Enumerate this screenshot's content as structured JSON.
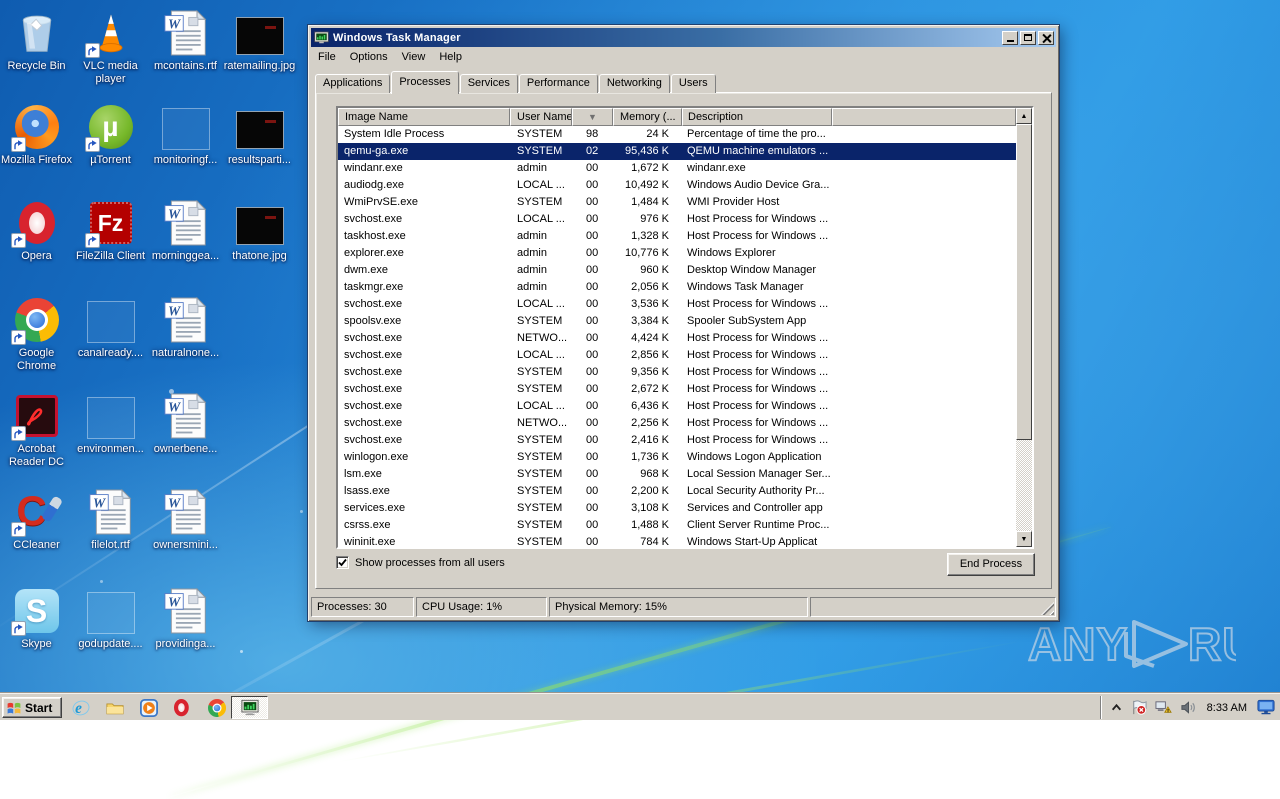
{
  "window": {
    "title": "Windows Task Manager",
    "menu": [
      "File",
      "Options",
      "View",
      "Help"
    ],
    "tabs": [
      "Applications",
      "Processes",
      "Services",
      "Performance",
      "Networking",
      "Users"
    ],
    "active_tab": "Processes",
    "processes": {
      "columns": [
        "Image Name",
        "User Name",
        "",
        "Memory (...",
        "Description"
      ],
      "sort_indicator": "▼",
      "selected_index": 1,
      "rows": [
        {
          "name": "System Idle Process",
          "user": "SYSTEM",
          "cpu": "98",
          "mem": "24 K",
          "desc": "Percentage of time the pro..."
        },
        {
          "name": "qemu-ga.exe",
          "user": "SYSTEM",
          "cpu": "02",
          "mem": "95,436 K",
          "desc": "QEMU machine emulators ..."
        },
        {
          "name": "windanr.exe",
          "user": "admin",
          "cpu": "00",
          "mem": "1,672 K",
          "desc": "windanr.exe"
        },
        {
          "name": "audiodg.exe",
          "user": "LOCAL ...",
          "cpu": "00",
          "mem": "10,492 K",
          "desc": "Windows Audio Device Gra..."
        },
        {
          "name": "WmiPrvSE.exe",
          "user": "SYSTEM",
          "cpu": "00",
          "mem": "1,484 K",
          "desc": "WMI Provider Host"
        },
        {
          "name": "svchost.exe",
          "user": "LOCAL ...",
          "cpu": "00",
          "mem": "976 K",
          "desc": "Host Process for Windows ..."
        },
        {
          "name": "taskhost.exe",
          "user": "admin",
          "cpu": "00",
          "mem": "1,328 K",
          "desc": "Host Process for Windows ..."
        },
        {
          "name": "explorer.exe",
          "user": "admin",
          "cpu": "00",
          "mem": "10,776 K",
          "desc": "Windows Explorer"
        },
        {
          "name": "dwm.exe",
          "user": "admin",
          "cpu": "00",
          "mem": "960 K",
          "desc": "Desktop Window Manager"
        },
        {
          "name": "taskmgr.exe",
          "user": "admin",
          "cpu": "00",
          "mem": "2,056 K",
          "desc": "Windows Task Manager"
        },
        {
          "name": "svchost.exe",
          "user": "LOCAL ...",
          "cpu": "00",
          "mem": "3,536 K",
          "desc": "Host Process for Windows ..."
        },
        {
          "name": "spoolsv.exe",
          "user": "SYSTEM",
          "cpu": "00",
          "mem": "3,384 K",
          "desc": "Spooler SubSystem App"
        },
        {
          "name": "svchost.exe",
          "user": "NETWO...",
          "cpu": "00",
          "mem": "4,424 K",
          "desc": "Host Process for Windows ..."
        },
        {
          "name": "svchost.exe",
          "user": "LOCAL ...",
          "cpu": "00",
          "mem": "2,856 K",
          "desc": "Host Process for Windows ..."
        },
        {
          "name": "svchost.exe",
          "user": "SYSTEM",
          "cpu": "00",
          "mem": "9,356 K",
          "desc": "Host Process for Windows ..."
        },
        {
          "name": "svchost.exe",
          "user": "SYSTEM",
          "cpu": "00",
          "mem": "2,672 K",
          "desc": "Host Process for Windows ..."
        },
        {
          "name": "svchost.exe",
          "user": "LOCAL ...",
          "cpu": "00",
          "mem": "6,436 K",
          "desc": "Host Process for Windows ..."
        },
        {
          "name": "svchost.exe",
          "user": "NETWO...",
          "cpu": "00",
          "mem": "2,256 K",
          "desc": "Host Process for Windows ..."
        },
        {
          "name": "svchost.exe",
          "user": "SYSTEM",
          "cpu": "00",
          "mem": "2,416 K",
          "desc": "Host Process for Windows ..."
        },
        {
          "name": "winlogon.exe",
          "user": "SYSTEM",
          "cpu": "00",
          "mem": "1,736 K",
          "desc": "Windows Logon Application"
        },
        {
          "name": "lsm.exe",
          "user": "SYSTEM",
          "cpu": "00",
          "mem": "968 K",
          "desc": "Local Session Manager Ser..."
        },
        {
          "name": "lsass.exe",
          "user": "SYSTEM",
          "cpu": "00",
          "mem": "2,200 K",
          "desc": "Local Security Authority Pr..."
        },
        {
          "name": "services.exe",
          "user": "SYSTEM",
          "cpu": "00",
          "mem": "3,108 K",
          "desc": "Services and Controller app"
        },
        {
          "name": "csrss.exe",
          "user": "SYSTEM",
          "cpu": "00",
          "mem": "1,488 K",
          "desc": "Client Server Runtime Proc..."
        },
        {
          "name": "wininit.exe",
          "user": "SYSTEM",
          "cpu": "00",
          "mem": "784 K",
          "desc": "Windows Start-Up Applicat"
        }
      ]
    },
    "show_all_label": "Show processes from all users",
    "show_all_checked": true,
    "end_process_label": "End Process",
    "status": [
      "Processes: 30",
      "CPU Usage: 1%",
      "Physical Memory: 15%"
    ]
  },
  "desktop": {
    "icons": [
      {
        "label": "Recycle Bin",
        "type": "recycle-bin",
        "col": 0,
        "row": 0,
        "shortcut": false
      },
      {
        "label": "VLC media player",
        "type": "vlc",
        "col": 1,
        "row": 0,
        "shortcut": true
      },
      {
        "label": "mcontains.rtf",
        "type": "word",
        "col": 2,
        "row": 0,
        "shortcut": false
      },
      {
        "label": "ratemailing.jpg",
        "type": "jpg",
        "col": 3,
        "row": 0,
        "shortcut": false
      },
      {
        "label": "Mozilla Firefox",
        "type": "firefox",
        "col": 0,
        "row": 1,
        "shortcut": true
      },
      {
        "label": "µTorrent",
        "type": "utorrent",
        "col": 1,
        "row": 1,
        "shortcut": true
      },
      {
        "label": "monitoringf...",
        "type": "ghost",
        "col": 2,
        "row": 1,
        "shortcut": false
      },
      {
        "label": "resultsparti...",
        "type": "jpg",
        "col": 3,
        "row": 1,
        "shortcut": false
      },
      {
        "label": "Opera",
        "type": "opera",
        "col": 0,
        "row": 2,
        "shortcut": true
      },
      {
        "label": "FileZilla Client",
        "type": "filezilla",
        "col": 1,
        "row": 2,
        "shortcut": true
      },
      {
        "label": "morninggea...",
        "type": "word",
        "col": 2,
        "row": 2,
        "shortcut": false
      },
      {
        "label": "thatone.jpg",
        "type": "jpg",
        "col": 3,
        "row": 2,
        "shortcut": false
      },
      {
        "label": "Google Chrome",
        "type": "chrome",
        "col": 0,
        "row": 3,
        "shortcut": true
      },
      {
        "label": "canalready....",
        "type": "ghost",
        "col": 1,
        "row": 3,
        "shortcut": false
      },
      {
        "label": "naturalnone...",
        "type": "word",
        "col": 2,
        "row": 3,
        "shortcut": false
      },
      {
        "label": "Acrobat Reader DC",
        "type": "acrobat",
        "col": 0,
        "row": 4,
        "shortcut": true
      },
      {
        "label": "environmen...",
        "type": "ghost",
        "col": 1,
        "row": 4,
        "shortcut": false
      },
      {
        "label": "ownerbene...",
        "type": "word",
        "col": 2,
        "row": 4,
        "shortcut": false
      },
      {
        "label": "CCleaner",
        "type": "ccleaner",
        "col": 0,
        "row": 5,
        "shortcut": true
      },
      {
        "label": "filelot.rtf",
        "type": "word",
        "col": 1,
        "row": 5,
        "shortcut": false
      },
      {
        "label": "ownersmini...",
        "type": "word",
        "col": 2,
        "row": 5,
        "shortcut": false
      },
      {
        "label": "Skype",
        "type": "skype",
        "col": 0,
        "row": 6,
        "shortcut": true
      },
      {
        "label": "godupdate....",
        "type": "ghost",
        "col": 1,
        "row": 6,
        "shortcut": false
      },
      {
        "label": "providinga...",
        "type": "word",
        "col": 2,
        "row": 6,
        "shortcut": false
      }
    ]
  },
  "taskbar": {
    "start_label": "Start",
    "quick_launch": [
      {
        "name": "internet-explorer",
        "type": "ie"
      },
      {
        "name": "windows-explorer",
        "type": "folder"
      },
      {
        "name": "media-player",
        "type": "wmp"
      },
      {
        "name": "opera",
        "type": "opera-sm"
      },
      {
        "name": "chrome",
        "type": "chrome-sm"
      }
    ],
    "active_task": "task-manager",
    "tray_time": "8:33 AM"
  },
  "watermark": {
    "left": "ANY",
    "right": "RUN"
  },
  "colors": {
    "titlebar_left": "#0a246a",
    "titlebar_right": "#a6caf0",
    "selection": "#0a246a",
    "chrome_gray": "#d4d0c8",
    "desktop_top": "#0f5cb0",
    "desktop_mid": "#2f9ce6",
    "green_streak": "#96e458"
  }
}
